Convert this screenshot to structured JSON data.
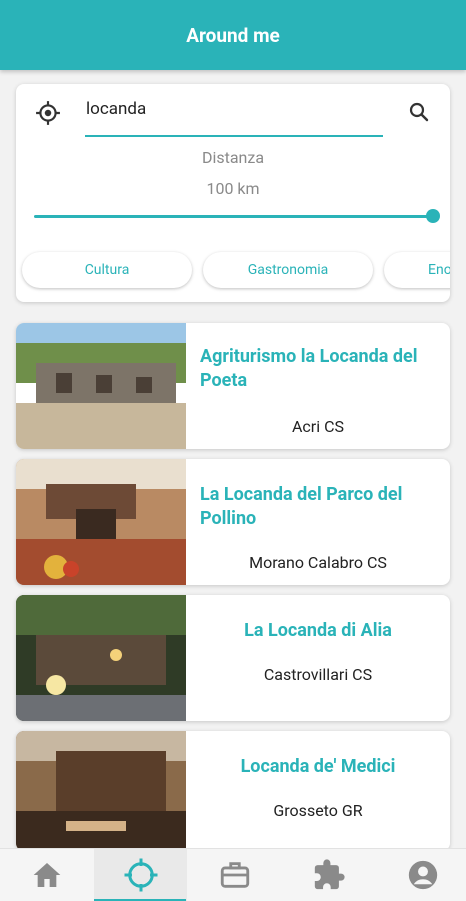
{
  "header": {
    "title": "Around me"
  },
  "search": {
    "query": "locanda",
    "distance_label": "Distanza",
    "distance_value": "100 km",
    "distance_level": 1.0
  },
  "categories": [
    "Cultura",
    "Gastronomia",
    "Eno"
  ],
  "places": [
    {
      "name": "Agriturismo la Locanda del Poeta",
      "city": "Acri CS"
    },
    {
      "name": "La Locanda del Parco del Pollino",
      "city": "Morano Calabro CS"
    },
    {
      "name": "La Locanda di Alia",
      "city": "Castrovillari CS"
    },
    {
      "name": "Locanda de' Medici",
      "city": "Grosseto GR"
    }
  ],
  "nav": [
    {
      "icon": "home-icon"
    },
    {
      "icon": "crosshair-icon"
    },
    {
      "icon": "briefcase-icon"
    },
    {
      "icon": "puzzle-icon"
    },
    {
      "icon": "account-icon"
    }
  ],
  "colors": {
    "accent": "#2ab3b8",
    "nav_icon": "#8a8a8a"
  }
}
